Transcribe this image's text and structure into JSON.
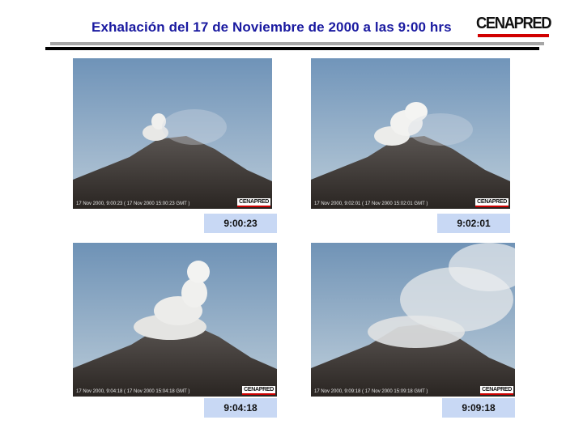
{
  "header": {
    "title": "Exhalación del 17 de Noviembre de 2000 a las 9:00 hrs",
    "logo_text": "CENAPRED"
  },
  "frames": [
    {
      "caption": "9:00:23",
      "stamp": "17 Nov 2000, 9:00:23 ( 17 Nov 2000 15:00:23 GMT )",
      "watermark": "CENAPRED"
    },
    {
      "caption": "9:02:01",
      "stamp": "17 Nov 2000, 9:02:01 ( 17 Nov 2000 15:02:01 GMT )",
      "watermark": "CENAPRED"
    },
    {
      "caption": "9:04:18",
      "stamp": "17 Nov 2000, 9:04:18 ( 17 Nov 2000 15:04:18 GMT )",
      "watermark": "CENAPRED"
    },
    {
      "caption": "9:09:18",
      "stamp": "17 Nov 2000, 9:09:18 ( 17 Nov 2000 15:09:18 GMT )",
      "watermark": "CENAPRED"
    }
  ],
  "colors": {
    "title": "#1a1aa0",
    "logo_underline": "#d00000",
    "caption_bg": "#c8d8f4"
  }
}
